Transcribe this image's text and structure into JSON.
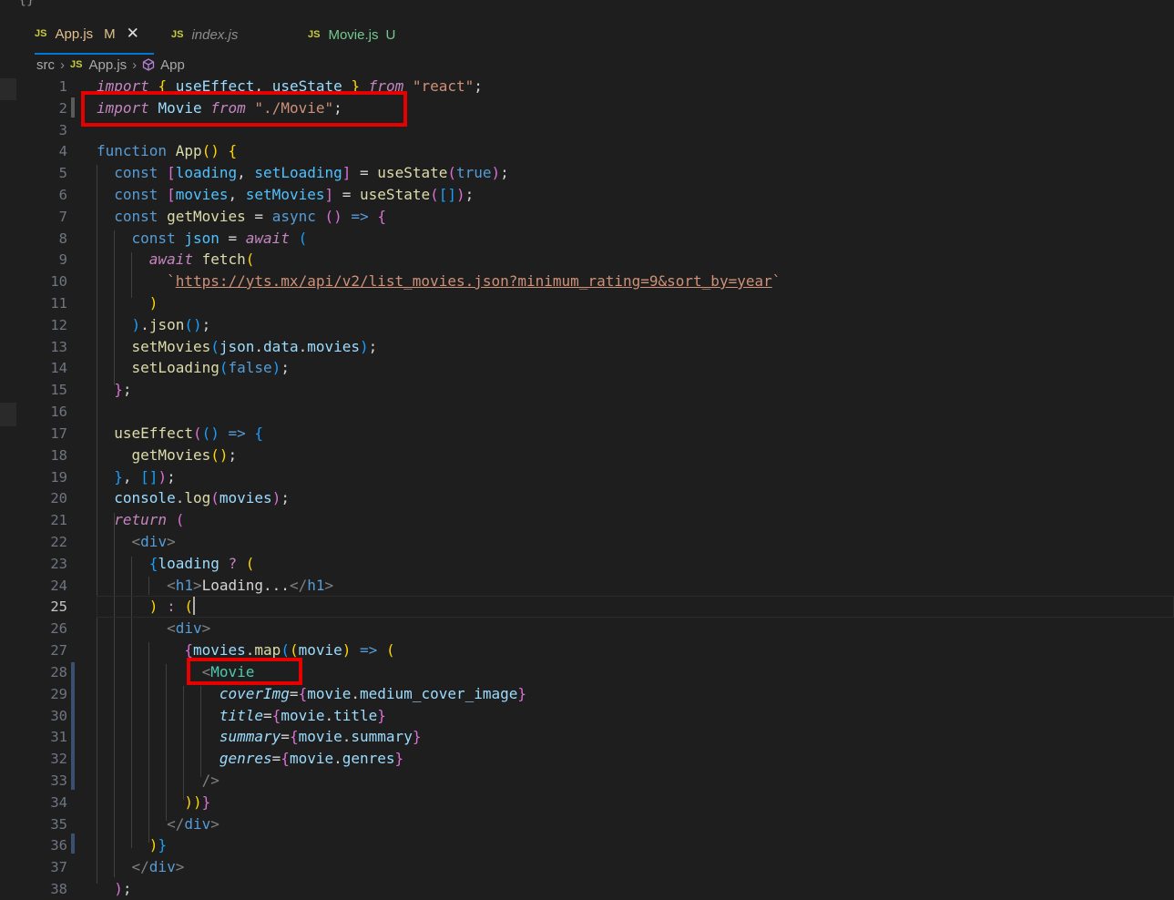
{
  "tabs": [
    {
      "icon": "JS",
      "name": "App.js",
      "status": "M",
      "active": true
    },
    {
      "icon": "JS",
      "name": "index.js",
      "status": "",
      "active": false
    },
    {
      "icon": "JS",
      "name": "Movie.js",
      "status": "U",
      "active": false
    }
  ],
  "breadcrumb": {
    "folder": "src",
    "file_icon": "JS",
    "file": "App.js",
    "symbol": "App"
  },
  "editor": {
    "current_line": 25,
    "line_numbers": [
      "1",
      "2",
      "3",
      "4",
      "5",
      "6",
      "7",
      "8",
      "9",
      "10",
      "11",
      "12",
      "13",
      "14",
      "15",
      "16",
      "17",
      "18",
      "19",
      "20",
      "21",
      "22",
      "23",
      "24",
      "25",
      "26",
      "27",
      "28",
      "29",
      "30",
      "31",
      "32",
      "33",
      "34",
      "35",
      "36",
      "37",
      "38"
    ],
    "url": "https://yts.mx/api/v2/list_movies.json?minimum_rating=9&sort_by=year"
  },
  "colors": {
    "background": "#1e1e1e",
    "annotation": "#e60000",
    "keyword": "#c586c0",
    "string": "#ce9178",
    "function": "#dcdcaa",
    "variable": "#9cdcfe",
    "component": "#4ec9b0"
  }
}
